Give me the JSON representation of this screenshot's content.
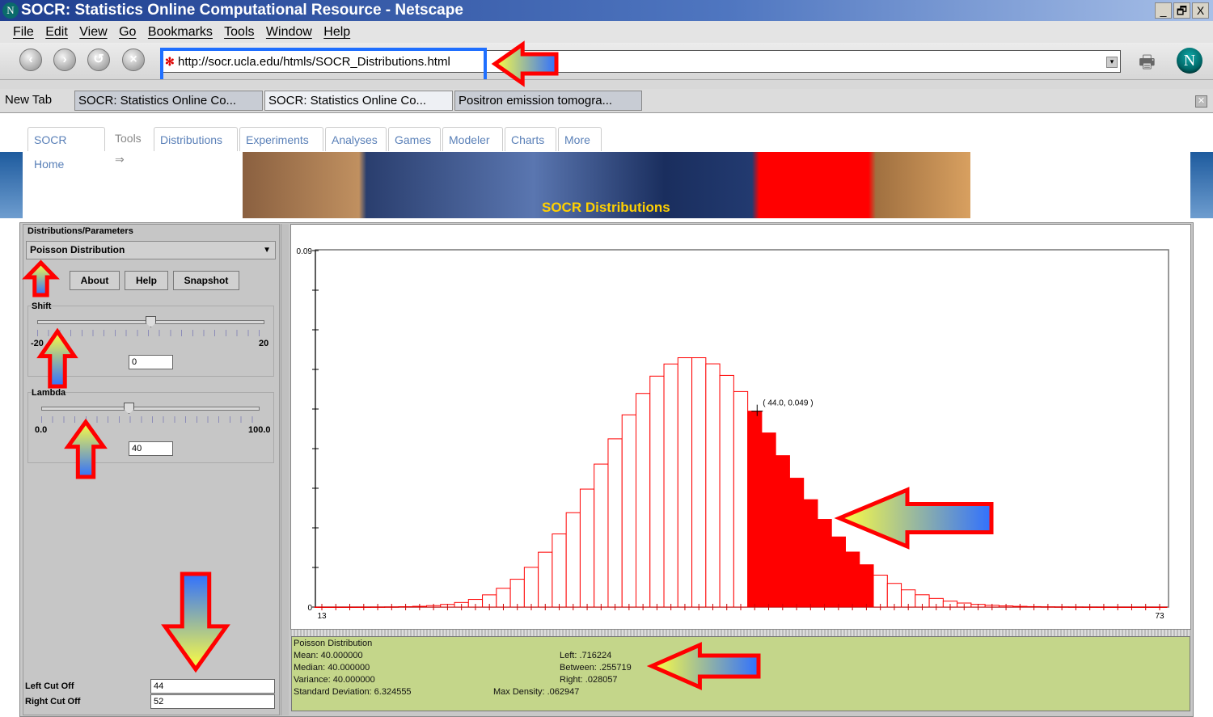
{
  "window": {
    "title": "SOCR: Statistics Online Computational Resource - Netscape",
    "controls": [
      "_",
      "🗗",
      "X"
    ]
  },
  "menu": [
    "File",
    "Edit",
    "View",
    "Go",
    "Bookmarks",
    "Tools",
    "Window",
    "Help"
  ],
  "url": "http://socr.ucla.edu/htmls/SOCR_Distributions.html",
  "browser_tabs": [
    {
      "label": "New Tab"
    },
    {
      "label": "SOCR: Statistics Online Co..."
    },
    {
      "label": "SOCR: Statistics Online Co...",
      "active": true
    },
    {
      "label": "Positron emission tomogra..."
    }
  ],
  "site_tabs": [
    "SOCR Home",
    "Tools ⇒",
    "Distributions",
    "Experiments",
    "Analyses",
    "Games",
    "Modeler",
    "Charts",
    "More"
  ],
  "banner_title": "SOCR Distributions",
  "left_panel": {
    "section_title": "Distributions/Parameters",
    "distribution": "Poisson Distribution",
    "buttons": [
      "About",
      "Help",
      "Snapshot"
    ],
    "shift": {
      "label": "Shift",
      "min": "-20",
      "max": "20",
      "value": "0"
    },
    "lambda": {
      "label": "Lambda",
      "min": "0.0",
      "max": "100.0",
      "value": "40"
    },
    "left_cut_label": "Left Cut Off",
    "left_cut": "44",
    "right_cut_label": "Right Cut Off",
    "right_cut": "52"
  },
  "chart_data": {
    "type": "bar",
    "xlim": [
      13,
      73
    ],
    "ylim": [
      0,
      0.09
    ],
    "x_tick_labels": [
      "13",
      "73"
    ],
    "y_tick_labels": [
      "0",
      "0.09"
    ],
    "highlight_range": [
      44,
      52
    ],
    "annotation": "( 44.0, 0.049 )",
    "colors": {
      "outline": "#ff0000",
      "fill": "#ff0000"
    },
    "x": [
      13,
      14,
      15,
      16,
      17,
      18,
      19,
      20,
      21,
      22,
      23,
      24,
      25,
      26,
      27,
      28,
      29,
      30,
      31,
      32,
      33,
      34,
      35,
      36,
      37,
      38,
      39,
      40,
      41,
      42,
      43,
      44,
      45,
      46,
      47,
      48,
      49,
      50,
      51,
      52,
      53,
      54,
      55,
      56,
      57,
      58,
      59,
      60,
      61,
      62,
      63,
      64,
      65,
      66,
      67,
      68,
      69,
      70,
      71,
      72,
      73
    ],
    "values": [
      5e-07,
      1e-06,
      4e-06,
      9e-06,
      2.1e-05,
      4.6e-05,
      9.6e-05,
      0.000192,
      0.000366,
      0.000665,
      0.001156,
      0.001927,
      0.003084,
      0.004744,
      0.007028,
      0.01004,
      0.013849,
      0.018465,
      0.023826,
      0.029783,
      0.0361,
      0.042471,
      0.048538,
      0.053931,
      0.058304,
      0.061373,
      0.062947,
      0.062947,
      0.061412,
      0.058487,
      0.054407,
      0.049461,
      0.043965,
      0.03823,
      0.032537,
      0.027114,
      0.022134,
      0.017707,
      0.013888,
      0.010683,
      0.008063,
      0.005972,
      0.004343,
      0.003102,
      0.002177,
      0.001501,
      0.001018,
      0.000679,
      0.000445,
      0.000287,
      0.000182,
      0.000114,
      7e-05,
      4.3e-05,
      2.6e-05,
      1.5e-05,
      9e-06,
      5e-06,
      3e-06,
      2e-06,
      1e-06
    ]
  },
  "stats": {
    "title": "Poisson Distribution",
    "mean": "Mean: 40.000000",
    "median": "Median: 40.000000",
    "variance": "Variance: 40.000000",
    "sd": "Standard Deviation: 6.324555",
    "left": "Left: .716224",
    "between": "Between: .255719",
    "right": "Right: .028057",
    "max_density": "Max Density: .062947"
  }
}
